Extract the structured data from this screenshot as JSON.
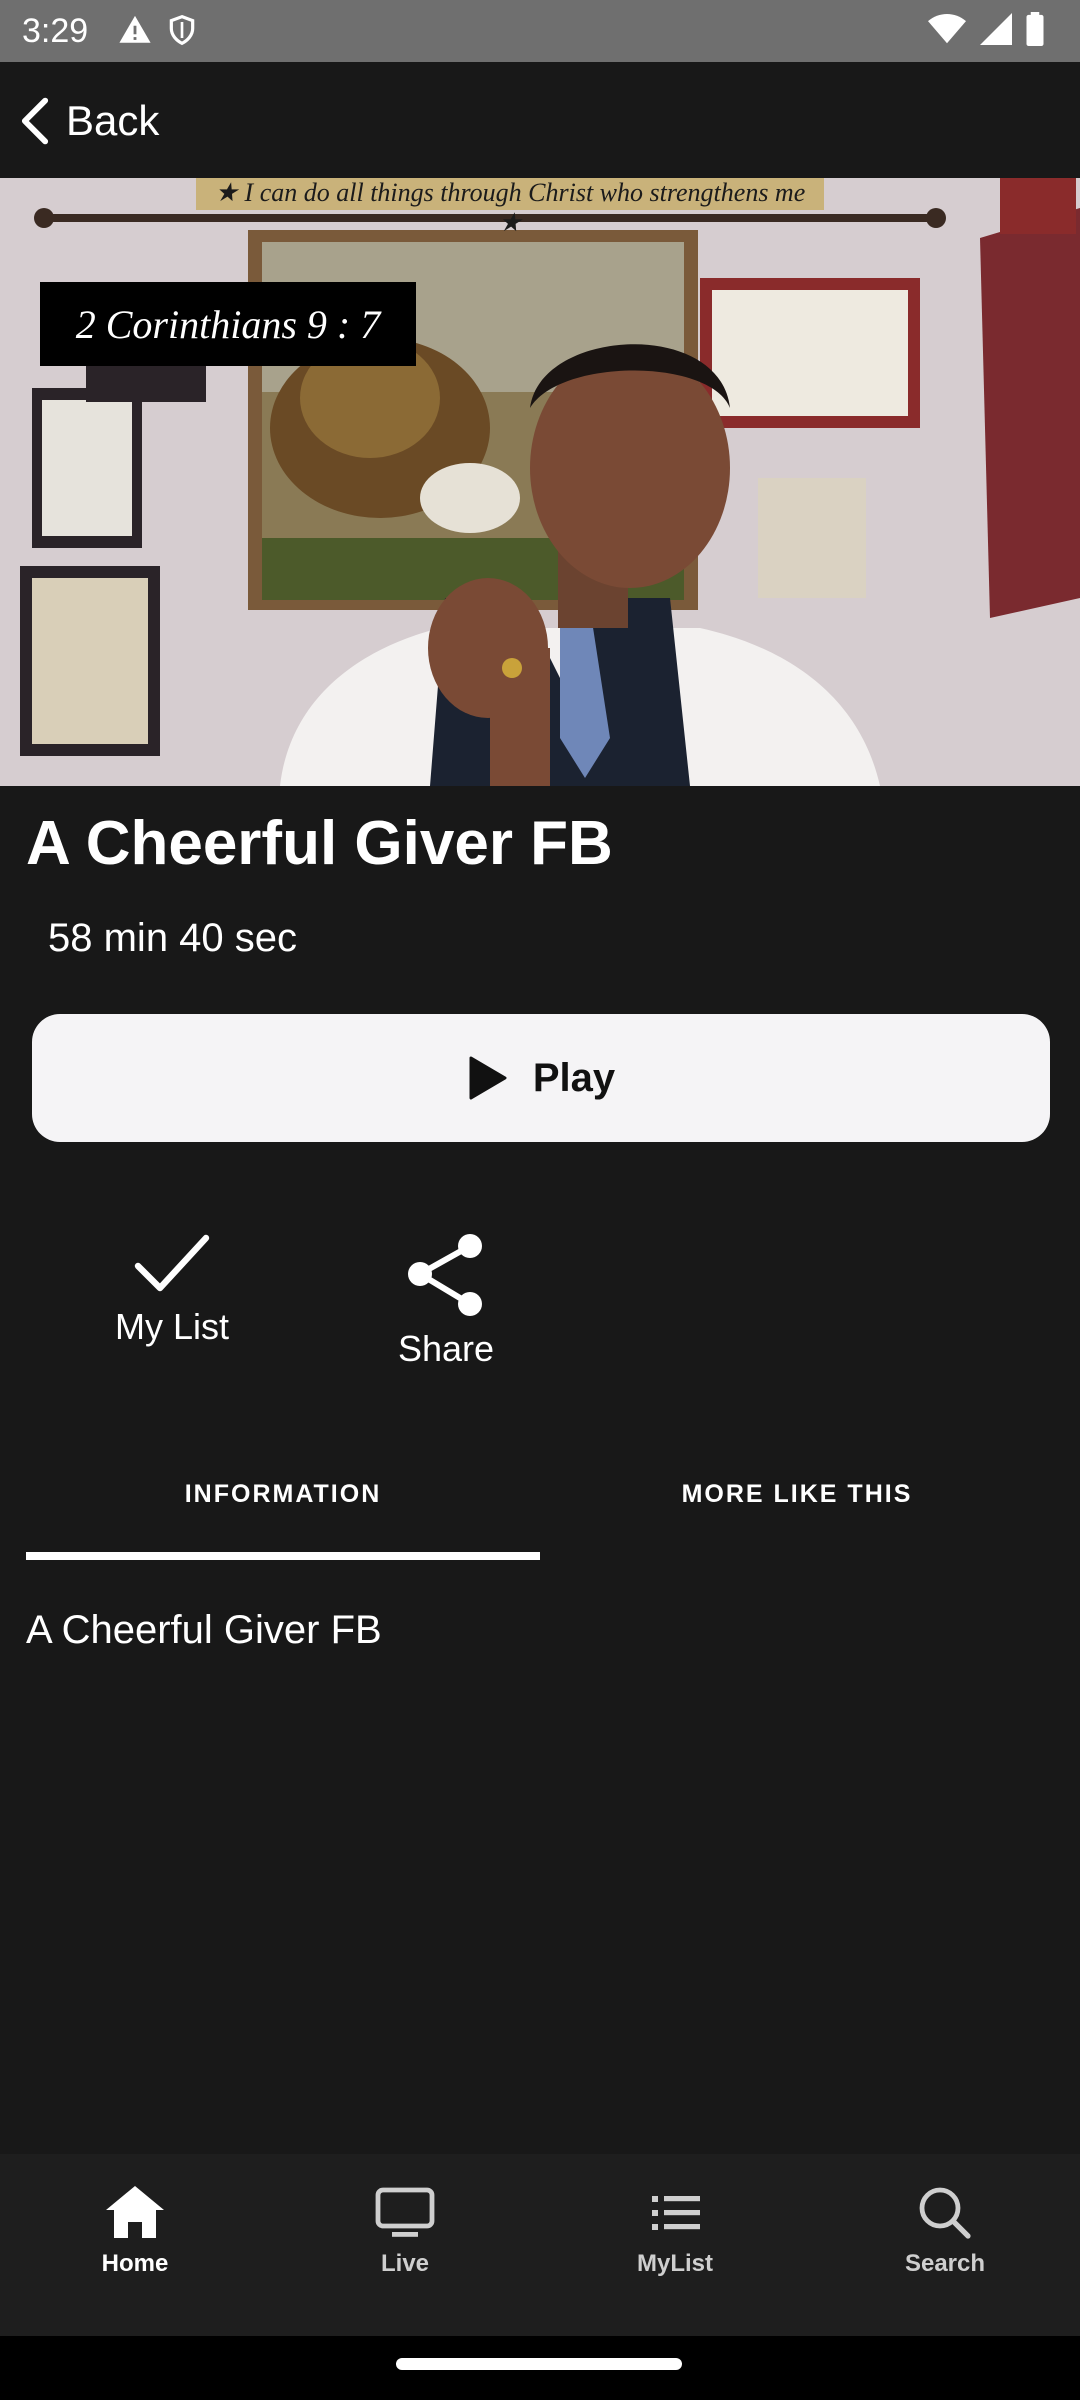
{
  "status_bar": {
    "time": "3:29",
    "left_icons": [
      "warning-icon",
      "shield-icon"
    ],
    "right_icons": [
      "wifi-icon",
      "signal-icon",
      "battery-icon"
    ]
  },
  "top_bar": {
    "back_label": "Back"
  },
  "hero": {
    "banner_text": "★ I can do all things through Christ who strengthens me ★",
    "caption": "2 Corinthians 9 : 7"
  },
  "video": {
    "title": "A Cheerful Giver FB",
    "duration": "58 min 40 sec"
  },
  "play_button": {
    "label": "Play"
  },
  "actions": {
    "my_list": {
      "label": "My List",
      "icon": "checkmark-icon"
    },
    "share": {
      "label": "Share",
      "icon": "share-icon"
    }
  },
  "tabs": [
    {
      "label": "INFORMATION",
      "selected": true
    },
    {
      "label": "MORE LIKE THIS",
      "selected": false
    }
  ],
  "information": {
    "description": "A Cheerful Giver FB"
  },
  "bottom_nav": [
    {
      "label": "Home",
      "icon": "home-icon",
      "selected": true
    },
    {
      "label": "Live",
      "icon": "tv-icon",
      "selected": false
    },
    {
      "label": "MyList",
      "icon": "list-icon",
      "selected": false
    },
    {
      "label": "Search",
      "icon": "search-icon",
      "selected": false
    }
  ],
  "colors": {
    "background": "#181818",
    "status_bar": "#6f6f6f",
    "play_button": "#f5f4f6",
    "text": "#ffffff",
    "nav_background": "#1e1e1e"
  }
}
